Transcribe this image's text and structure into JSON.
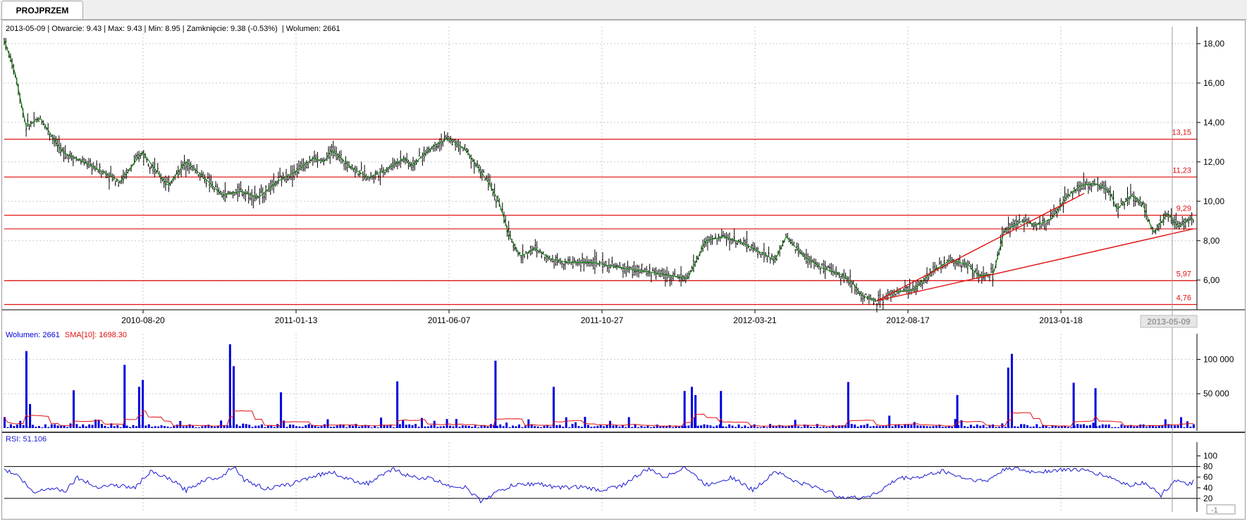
{
  "tab": {
    "label": "PROJPRZEM"
  },
  "info_bar": {
    "date": "2013-05-09",
    "open": "Otwarcie: 9.43",
    "max": "Max: 9.43",
    "min": "Min: 8.95",
    "close": "Zamknięcie: 9.38 (-0.53%)",
    "volume": "Wolumen: 2661"
  },
  "crosshair_date_label": "2013-05-09",
  "volume_panel": {
    "label": "Wolumen: 2661",
    "sma_label": "SMA[10]: 1698.30"
  },
  "rsi_panel": {
    "label": "RSI: 51.106",
    "corner_label": "-1"
  },
  "colors": {
    "candle": "#000000",
    "ma": "#1a8a1a",
    "hline": "#e01010",
    "volume": "#0000dd",
    "sma": "#e01010",
    "rsi": "#1a1ad4",
    "grid": "#c8c8c8"
  },
  "chart_data": [
    {
      "type": "candlestick",
      "title": "",
      "x_tick_labels": [
        "2010-08-20",
        "2011-01-13",
        "2011-06-07",
        "2011-10-27",
        "2012-03-21",
        "2012-08-17",
        "2013-01-18"
      ],
      "y_tick_labels": [
        "6,00",
        "8,00",
        "10,00",
        "12,00",
        "14,00",
        "16,00",
        "18,00"
      ],
      "ylim": [
        4.6,
        18.5
      ],
      "grid": true,
      "price_path": [
        {
          "x": 0,
          "y": 18.2
        },
        {
          "x": 0.03,
          "y": 16.5
        },
        {
          "x": 0.06,
          "y": 13.8
        },
        {
          "x": 0.1,
          "y": 14.2
        },
        {
          "x": 0.16,
          "y": 12.5
        },
        {
          "x": 0.25,
          "y": 11.7
        },
        {
          "x": 0.32,
          "y": 11.0
        },
        {
          "x": 0.38,
          "y": 12.5
        },
        {
          "x": 0.42,
          "y": 11.5
        },
        {
          "x": 0.45,
          "y": 10.8
        },
        {
          "x": 0.5,
          "y": 12.0
        },
        {
          "x": 0.55,
          "y": 11.2
        },
        {
          "x": 0.6,
          "y": 10.3
        },
        {
          "x": 0.65,
          "y": 10.5
        },
        {
          "x": 0.7,
          "y": 10.2
        },
        {
          "x": 0.75,
          "y": 11.0
        },
        {
          "x": 0.8,
          "y": 11.5
        },
        {
          "x": 0.85,
          "y": 12.2
        },
        {
          "x": 0.88,
          "y": 12.0
        },
        {
          "x": 0.9,
          "y": 12.6
        },
        {
          "x": 0.95,
          "y": 11.8
        },
        {
          "x": 1.0,
          "y": 11.2
        },
        {
          "x": 1.05,
          "y": 11.6
        },
        {
          "x": 1.1,
          "y": 12.2
        },
        {
          "x": 1.12,
          "y": 11.8
        },
        {
          "x": 1.18,
          "y": 12.8
        },
        {
          "x": 1.22,
          "y": 13.2
        },
        {
          "x": 1.27,
          "y": 12.6
        },
        {
          "x": 1.3,
          "y": 11.8
        },
        {
          "x": 1.33,
          "y": 11.0
        },
        {
          "x": 1.36,
          "y": 10.0
        },
        {
          "x": 1.39,
          "y": 8.2
        },
        {
          "x": 1.42,
          "y": 7.2
        },
        {
          "x": 1.46,
          "y": 7.6
        },
        {
          "x": 1.5,
          "y": 7.1
        },
        {
          "x": 1.55,
          "y": 6.9
        },
        {
          "x": 1.62,
          "y": 6.9
        },
        {
          "x": 1.7,
          "y": 6.6
        },
        {
          "x": 1.78,
          "y": 6.4
        },
        {
          "x": 1.84,
          "y": 6.2
        },
        {
          "x": 1.88,
          "y": 6.1
        },
        {
          "x": 1.93,
          "y": 8.0
        },
        {
          "x": 1.98,
          "y": 8.2
        },
        {
          "x": 2.03,
          "y": 7.9
        },
        {
          "x": 2.08,
          "y": 7.4
        },
        {
          "x": 2.12,
          "y": 7.0
        },
        {
          "x": 2.15,
          "y": 8.2
        },
        {
          "x": 2.2,
          "y": 7.2
        },
        {
          "x": 2.25,
          "y": 6.6
        },
        {
          "x": 2.3,
          "y": 6.3
        },
        {
          "x": 2.33,
          "y": 5.9
        },
        {
          "x": 2.36,
          "y": 5.2
        },
        {
          "x": 2.4,
          "y": 4.95
        },
        {
          "x": 2.45,
          "y": 5.4
        },
        {
          "x": 2.5,
          "y": 5.5
        },
        {
          "x": 2.55,
          "y": 6.4
        },
        {
          "x": 2.6,
          "y": 7.0
        },
        {
          "x": 2.65,
          "y": 6.8
        },
        {
          "x": 2.68,
          "y": 6.2
        },
        {
          "x": 2.72,
          "y": 6.3
        },
        {
          "x": 2.75,
          "y": 8.5
        },
        {
          "x": 2.8,
          "y": 9.0
        },
        {
          "x": 2.84,
          "y": 8.8
        },
        {
          "x": 2.88,
          "y": 9.1
        },
        {
          "x": 2.92,
          "y": 10.2
        },
        {
          "x": 2.96,
          "y": 10.8
        },
        {
          "x": 3.0,
          "y": 10.9
        },
        {
          "x": 3.04,
          "y": 10.5
        },
        {
          "x": 3.06,
          "y": 9.6
        },
        {
          "x": 3.1,
          "y": 10.3
        },
        {
          "x": 3.13,
          "y": 9.9
        },
        {
          "x": 3.16,
          "y": 8.4
        },
        {
          "x": 3.2,
          "y": 9.4
        },
        {
          "x": 3.23,
          "y": 8.7
        },
        {
          "x": 3.26,
          "y": 9.1
        }
      ],
      "horizontal_lines": [
        {
          "value": 13.15,
          "label": "13,15"
        },
        {
          "value": 11.23,
          "label": "11,23"
        },
        {
          "value": 9.29,
          "label": "9,29"
        },
        {
          "value": 8.6,
          "label": ""
        },
        {
          "value": 5.97,
          "label": "5,97"
        },
        {
          "value": 4.76,
          "label": "4,76"
        }
      ],
      "trendlines": [
        {
          "x1": 2.4,
          "y1": 4.95,
          "x2": 2.97,
          "y2": 10.4
        },
        {
          "x1": 2.4,
          "y1": 4.95,
          "x2": 3.27,
          "y2": 8.6
        }
      ]
    },
    {
      "type": "bar",
      "title": "Wolumen",
      "series": [
        {
          "name": "Wolumen"
        },
        {
          "name": "SMA[10]"
        }
      ],
      "y_tick_labels": [
        "50 000",
        "100 000"
      ],
      "ylim": [
        0,
        125000
      ],
      "spikes": [
        {
          "x": 0.06,
          "v": 112000
        },
        {
          "x": 0.07,
          "v": 35000
        },
        {
          "x": 0.19,
          "v": 55000
        },
        {
          "x": 0.33,
          "v": 92000
        },
        {
          "x": 0.37,
          "v": 60000
        },
        {
          "x": 0.38,
          "v": 70000
        },
        {
          "x": 0.62,
          "v": 122000
        },
        {
          "x": 0.63,
          "v": 90000
        },
        {
          "x": 0.76,
          "v": 52000
        },
        {
          "x": 1.08,
          "v": 68000
        },
        {
          "x": 1.35,
          "v": 98000
        },
        {
          "x": 1.51,
          "v": 60000
        },
        {
          "x": 1.87,
          "v": 54000
        },
        {
          "x": 1.89,
          "v": 60000
        },
        {
          "x": 1.9,
          "v": 48000
        },
        {
          "x": 1.97,
          "v": 54000
        },
        {
          "x": 2.32,
          "v": 67000
        },
        {
          "x": 2.62,
          "v": 48000
        },
        {
          "x": 2.76,
          "v": 88000
        },
        {
          "x": 2.77,
          "v": 108000
        },
        {
          "x": 2.94,
          "v": 66000
        },
        {
          "x": 3.0,
          "v": 58000
        }
      ]
    },
    {
      "type": "line",
      "title": "RSI",
      "y_tick_labels": [
        "20",
        "40",
        "60",
        "80",
        "100"
      ],
      "ylim": [
        0,
        110
      ],
      "levels": [
        20,
        80
      ],
      "rsi_path": [
        {
          "x": 0,
          "y": 75
        },
        {
          "x": 0.04,
          "y": 62
        },
        {
          "x": 0.08,
          "y": 30
        },
        {
          "x": 0.12,
          "y": 40
        },
        {
          "x": 0.17,
          "y": 35
        },
        {
          "x": 0.2,
          "y": 60
        },
        {
          "x": 0.25,
          "y": 42
        },
        {
          "x": 0.3,
          "y": 45
        },
        {
          "x": 0.36,
          "y": 40
        },
        {
          "x": 0.4,
          "y": 70
        },
        {
          "x": 0.46,
          "y": 55
        },
        {
          "x": 0.5,
          "y": 35
        },
        {
          "x": 0.55,
          "y": 55
        },
        {
          "x": 0.6,
          "y": 62
        },
        {
          "x": 0.63,
          "y": 82
        },
        {
          "x": 0.66,
          "y": 55
        },
        {
          "x": 0.72,
          "y": 38
        },
        {
          "x": 0.78,
          "y": 45
        },
        {
          "x": 0.84,
          "y": 60
        },
        {
          "x": 0.9,
          "y": 70
        },
        {
          "x": 0.95,
          "y": 55
        },
        {
          "x": 1.0,
          "y": 48
        },
        {
          "x": 1.07,
          "y": 75
        },
        {
          "x": 1.12,
          "y": 60
        },
        {
          "x": 1.17,
          "y": 58
        },
        {
          "x": 1.22,
          "y": 45
        },
        {
          "x": 1.27,
          "y": 40
        },
        {
          "x": 1.31,
          "y": 15
        },
        {
          "x": 1.35,
          "y": 30
        },
        {
          "x": 1.4,
          "y": 45
        },
        {
          "x": 1.47,
          "y": 48
        },
        {
          "x": 1.52,
          "y": 40
        },
        {
          "x": 1.58,
          "y": 42
        },
        {
          "x": 1.64,
          "y": 35
        },
        {
          "x": 1.7,
          "y": 45
        },
        {
          "x": 1.77,
          "y": 75
        },
        {
          "x": 1.82,
          "y": 60
        },
        {
          "x": 1.87,
          "y": 80
        },
        {
          "x": 1.93,
          "y": 45
        },
        {
          "x": 2.0,
          "y": 60
        },
        {
          "x": 2.06,
          "y": 35
        },
        {
          "x": 2.12,
          "y": 72
        },
        {
          "x": 2.18,
          "y": 50
        },
        {
          "x": 2.24,
          "y": 40
        },
        {
          "x": 2.29,
          "y": 25
        },
        {
          "x": 2.35,
          "y": 20
        },
        {
          "x": 2.4,
          "y": 30
        },
        {
          "x": 2.46,
          "y": 58
        },
        {
          "x": 2.52,
          "y": 60
        },
        {
          "x": 2.58,
          "y": 72
        },
        {
          "x": 2.64,
          "y": 58
        },
        {
          "x": 2.7,
          "y": 52
        },
        {
          "x": 2.76,
          "y": 78
        },
        {
          "x": 2.82,
          "y": 70
        },
        {
          "x": 2.88,
          "y": 72
        },
        {
          "x": 2.94,
          "y": 75
        },
        {
          "x": 2.99,
          "y": 70
        },
        {
          "x": 3.04,
          "y": 60
        },
        {
          "x": 3.09,
          "y": 45
        },
        {
          "x": 3.14,
          "y": 50
        },
        {
          "x": 3.18,
          "y": 25
        },
        {
          "x": 3.22,
          "y": 55
        },
        {
          "x": 3.25,
          "y": 45
        },
        {
          "x": 3.27,
          "y": 51
        }
      ]
    }
  ]
}
